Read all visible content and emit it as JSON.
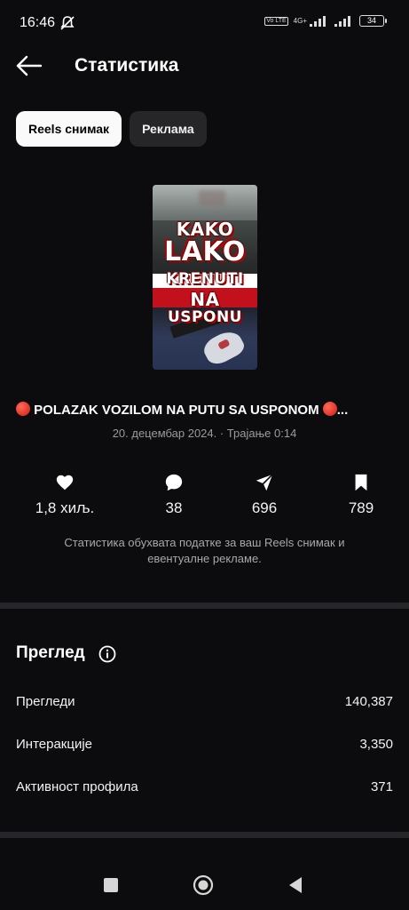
{
  "status_bar": {
    "time": "16:46",
    "network_type": "4G+",
    "volte_label": "Vo LTE",
    "battery": "34"
  },
  "header": {
    "title": "Статистика"
  },
  "tabs": [
    {
      "label": "Reels снимак",
      "active": true
    },
    {
      "label": "Реклама",
      "active": false
    }
  ],
  "thumbnail": {
    "lines": [
      "KAKO",
      "LAKO",
      "KRENUTI",
      "NA",
      "USPONU"
    ]
  },
  "reel": {
    "title": "POLAZAK VOZILOM NA PUTU SA USPONOM",
    "title_suffix": "...",
    "meta": "20. децембар 2024. · Трајање 0:14"
  },
  "stats": {
    "likes": "1,8 хиљ.",
    "comments": "38",
    "shares": "696",
    "saves": "789",
    "note": "Статистика обухвата податке за ваш Reels снимак и евентуалне рекламе."
  },
  "overview": {
    "title": "Преглед",
    "rows": [
      {
        "label": "Прегледи",
        "value": "140,387"
      },
      {
        "label": "Интеракције",
        "value": "3,350"
      },
      {
        "label": "Активност профила",
        "value": "371"
      }
    ]
  },
  "colors": {
    "background": "#0c0c0e",
    "active_tab": "#fafafa",
    "inactive_tab": "#262628",
    "muted_text": "#9a9a9e",
    "red_dot": "#d01c10"
  },
  "icons": [
    "back-arrow-icon",
    "heart-icon",
    "comment-icon",
    "share-icon",
    "bookmark-icon",
    "info-icon",
    "recents-icon",
    "home-icon",
    "back-nav-icon"
  ]
}
